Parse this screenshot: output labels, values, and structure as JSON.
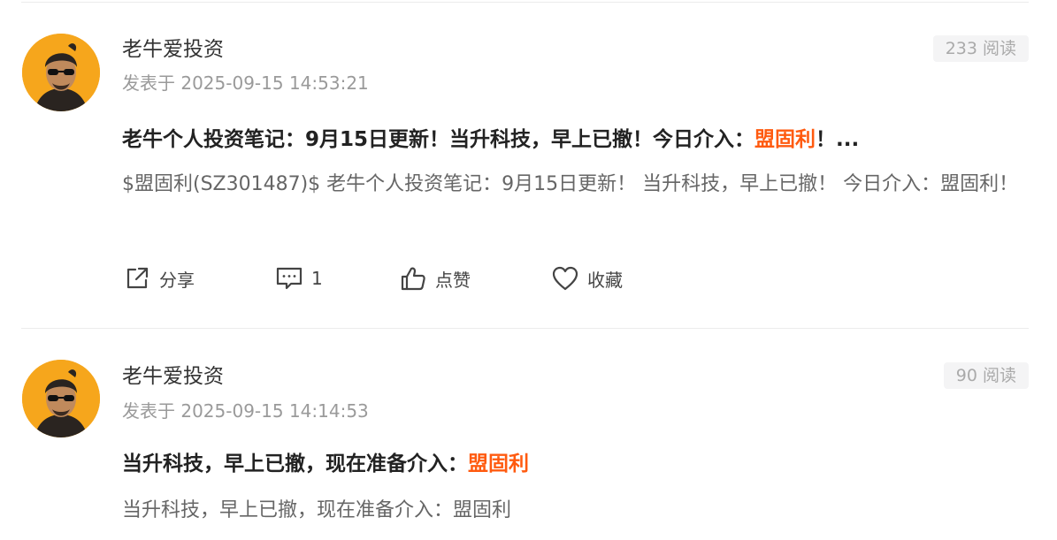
{
  "posts": [
    {
      "author": "老牛爱投资",
      "meta": "发表于 2025-09-15 14:53:21",
      "reads": "233 阅读",
      "title_prefix": "老牛个人投资笔记：9月15日更新！当升科技，早上已撤！今日介入：",
      "title_highlight": "盟固利",
      "title_suffix": "！...",
      "body": "$盟固利(SZ301487)$ 老牛个人投资笔记：9月15日更新！ 当升科技，早上已撤！ 今日介入：盟固利！",
      "actions": {
        "share_label": "分享",
        "comment_count": "1",
        "like_label": "点赞",
        "favorite_label": "收藏"
      }
    },
    {
      "author": "老牛爱投资",
      "meta": "发表于 2025-09-15 14:14:53",
      "reads": "90 阅读",
      "title_prefix": "当升科技，早上已撤，现在准备介入：",
      "title_highlight": "盟固利",
      "title_suffix": "",
      "body": "当升科技，早上已撤，现在准备介入：盟固利"
    }
  ],
  "colors": {
    "highlight": "#ff5a0f",
    "avatar_bg": "#f6a61c"
  },
  "icons": [
    "share-icon",
    "comment-icon",
    "thumbs-up-icon",
    "heart-icon"
  ]
}
